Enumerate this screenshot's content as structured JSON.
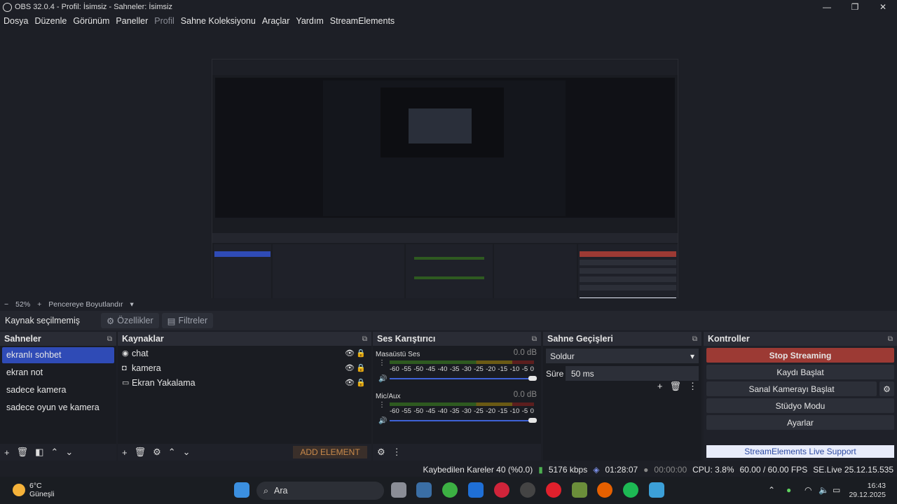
{
  "window": {
    "title": "OBS 32.0.4 - Profil: İsimsiz - Sahneler: İsimsiz"
  },
  "menu": [
    "Dosya",
    "Düzenle",
    "Görünüm",
    "Paneller",
    "Profil",
    "Sahne Koleksiyonu",
    "Araçlar",
    "Yardım",
    "StreamElements"
  ],
  "scale": {
    "minus": "−",
    "zoom": "52%",
    "plus": "+",
    "fit": "Pencereye Boyutlandır"
  },
  "source_toolbar": {
    "label": "Kaynak seçilmemiş",
    "properties": "Özellikler",
    "filters": "Filtreler"
  },
  "scenes": {
    "title": "Sahneler",
    "items": [
      "ekranlı sohbet",
      "ekran not",
      "sadece kamera",
      "sadece oyun ve kamera"
    ]
  },
  "sources": {
    "title": "Kaynaklar",
    "items": [
      "chat",
      "kamera",
      "Ekran Yakalama"
    ],
    "add_element": "ADD ELEMENT"
  },
  "mixer": {
    "title": "Ses Karıştırıcı",
    "channels": [
      {
        "name": "Masaüstü Ses",
        "db": "0.0 dB",
        "level": 0.0
      },
      {
        "name": "Mic/Aux",
        "db": "0.0 dB",
        "level": 0.1
      }
    ],
    "ticks": [
      "-60",
      "-55",
      "-50",
      "-45",
      "-40",
      "-35",
      "-30",
      "-25",
      "-20",
      "-15",
      "-10",
      "-5",
      "0"
    ]
  },
  "transitions": {
    "title": "Sahne Geçişleri",
    "type": "Soldur",
    "duration_label": "Süre",
    "duration": "50 ms"
  },
  "controls": {
    "title": "Kontroller",
    "stop": "Stop Streaming",
    "record": "Kaydı Başlat",
    "virtual_cam": "Sanal Kamerayı Başlat",
    "studio": "Stüdyo Modu",
    "settings": "Ayarlar",
    "support": "StreamElements Live Support"
  },
  "status": {
    "dropped": "Kaybedilen Kareler 40 (%0.0)",
    "kbps": "5176 kbps",
    "stream_time": "01:28:07",
    "rec_time": "00:00:00",
    "cpu": "CPU: 3.8%",
    "fps": "60.00 / 60.00 FPS",
    "version": "SE.Live 25.12.15.535"
  },
  "taskbar": {
    "temp": "6°C",
    "weather": "Güneşli",
    "search": "Ara",
    "time": "16:43",
    "date": "29.12.2025"
  },
  "colors": {
    "accent": "#2f4bb6",
    "stop": "#9c3a34"
  }
}
